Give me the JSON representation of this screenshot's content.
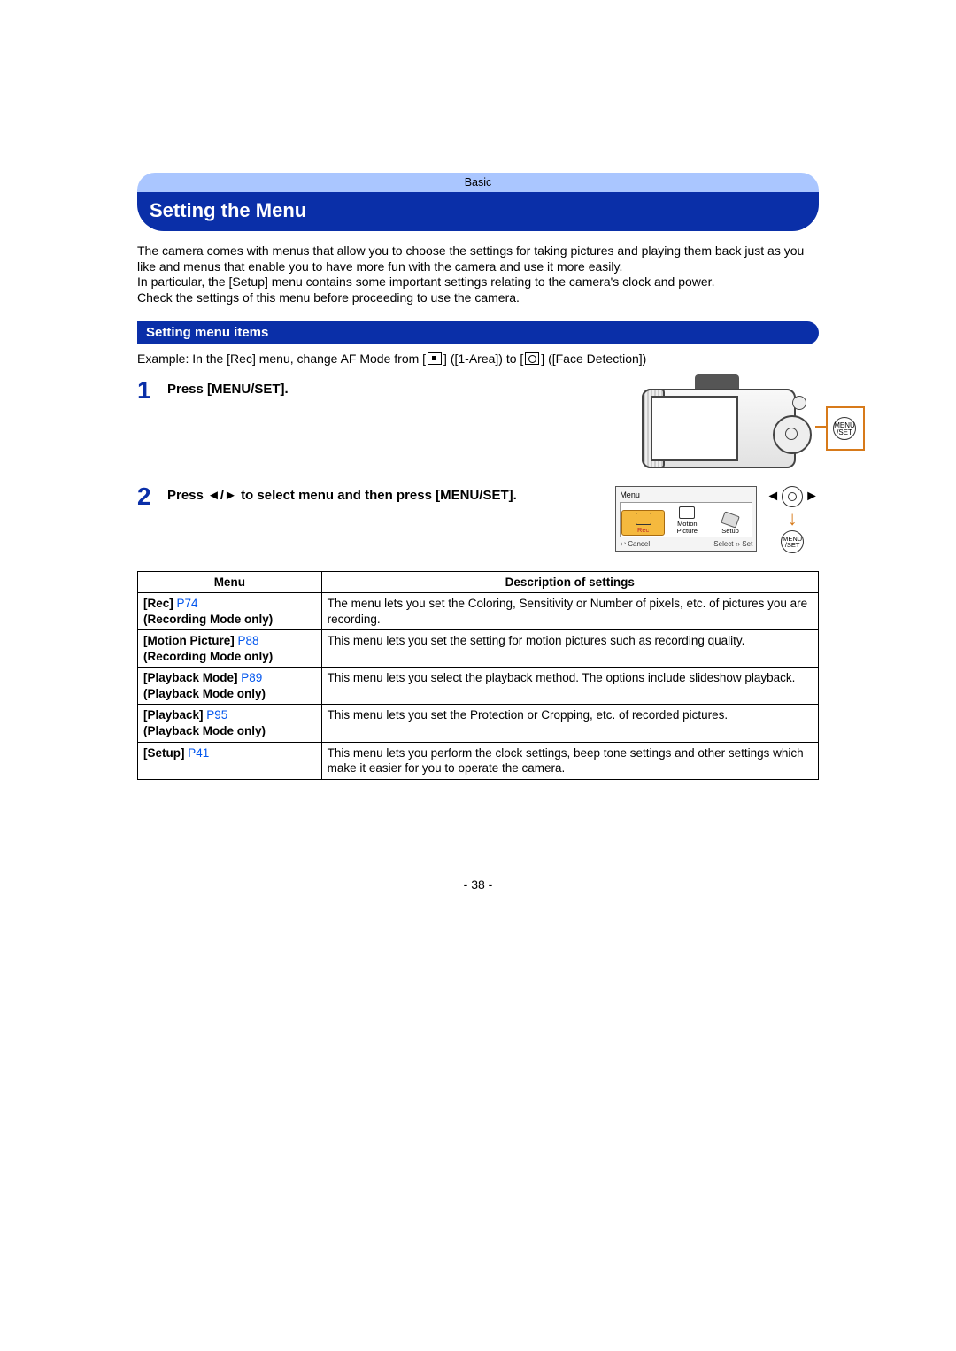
{
  "topband": "Basic",
  "title": "Setting the Menu",
  "intro_p1": "The camera comes with menus that allow you to choose the settings for taking pictures and playing them back just as you like and menus that enable you to have more fun with the camera and use it more easily.",
  "intro_p2": "In particular, the [Setup] menu contains some important settings relating to the camera's clock and power.",
  "intro_p3": "Check the settings of this menu before proceeding to use the camera.",
  "subhead": "Setting menu items",
  "example_prefix": "Example: In the [Rec] menu, change AF Mode from [",
  "example_mid1": "] ([1-Area]) to [",
  "example_mid2": "] ([Face Detection])",
  "steps": {
    "s1_num": "1",
    "s1_text": "Press [MENU/SET].",
    "s2_num": "2",
    "s2_text": "Press ◄/► to select menu and then press [MENU/SET]."
  },
  "menuset_label": "MENU /SET",
  "menu_screen": {
    "title": "Menu",
    "rec": "Rec",
    "motion": "Motion Picture",
    "setup": "Setup",
    "cancel": "↩ Cancel",
    "select": "Select ‹› Set"
  },
  "table": {
    "h1": "Menu",
    "h2": "Description of settings",
    "rows": [
      {
        "menu_bold": "[Rec] ",
        "menu_link": "P74",
        "menu_note": "(Recording Mode only)",
        "desc": "The menu lets you set the Coloring, Sensitivity or Number of pixels, etc. of pictures you are recording."
      },
      {
        "menu_bold": "[Motion Picture] ",
        "menu_link": "P88",
        "menu_note": "(Recording Mode only)",
        "desc": "This menu lets you set the setting for motion pictures such as recording quality."
      },
      {
        "menu_bold": "[Playback Mode] ",
        "menu_link": "P89",
        "menu_note": "(Playback Mode only)",
        "desc": "This menu lets you select the playback method. The options include slideshow playback."
      },
      {
        "menu_bold": "[Playback] ",
        "menu_link": "P95",
        "menu_note": "(Playback Mode only)",
        "desc": "This menu lets you set the Protection or Cropping, etc. of recorded pictures."
      },
      {
        "menu_bold": "[Setup] ",
        "menu_link": "P41",
        "menu_note": "",
        "desc": "This menu lets you perform the clock settings, beep tone settings and other settings which make it easier for you to operate the camera."
      }
    ]
  },
  "page_number": "- 38 -"
}
